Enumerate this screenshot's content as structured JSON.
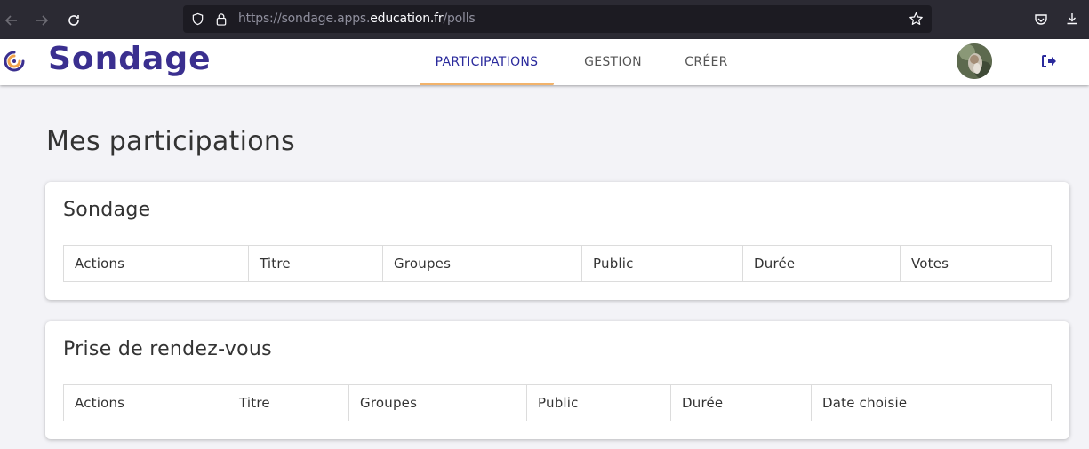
{
  "browser": {
    "url_prefix": "https://sondage.apps.",
    "url_domain": "education.fr",
    "url_suffix": "/polls"
  },
  "header": {
    "app_name": "Sondage",
    "tabs": [
      {
        "label": "PARTICIPATIONS",
        "active": true
      },
      {
        "label": "GESTION",
        "active": false
      },
      {
        "label": "CRÉER",
        "active": false
      }
    ],
    "accent_color": "#f2b36b",
    "brand_color": "#3a2f8f"
  },
  "main": {
    "title": "Mes participations",
    "sections": [
      {
        "title": "Sondage",
        "columns": [
          "Actions",
          "Titre",
          "Groupes",
          "Public",
          "Durée",
          "Votes"
        ]
      },
      {
        "title": "Prise de rendez-vous",
        "columns": [
          "Actions",
          "Titre",
          "Groupes",
          "Public",
          "Durée",
          "Date choisie"
        ]
      }
    ]
  }
}
